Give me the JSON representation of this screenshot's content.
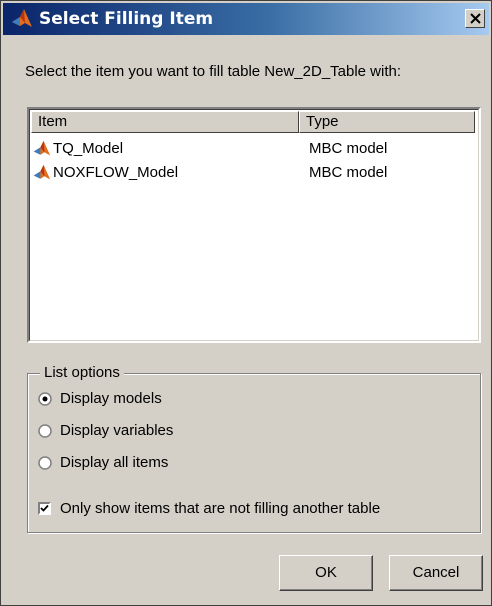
{
  "window": {
    "title": "Select Filling Item",
    "title_icon": "matlab-membrane-icon",
    "close_icon": "close-icon"
  },
  "prompt": "Select the item you want to fill table New_2D_Table with:",
  "list": {
    "columns": [
      "Item",
      "Type"
    ],
    "rows": [
      {
        "name": "TQ_Model",
        "type": "MBC model",
        "icon": "model-icon"
      },
      {
        "name": "NOXFLOW_Model",
        "type": "MBC model",
        "icon": "model-icon"
      }
    ]
  },
  "list_options": {
    "title": "List options",
    "radios": [
      {
        "label": "Display models",
        "selected": true
      },
      {
        "label": "Display variables",
        "selected": false
      },
      {
        "label": "Display all items",
        "selected": false
      }
    ],
    "checkbox": {
      "label": "Only show items that are not filling another table",
      "checked": true
    }
  },
  "buttons": {
    "ok": "OK",
    "cancel": "Cancel"
  },
  "colors": {
    "titlebar_start": "#0a246a",
    "titlebar_end": "#a6caf0",
    "dialog_bg": "#d4d0c8",
    "icon_orange": "#e36d1d"
  }
}
